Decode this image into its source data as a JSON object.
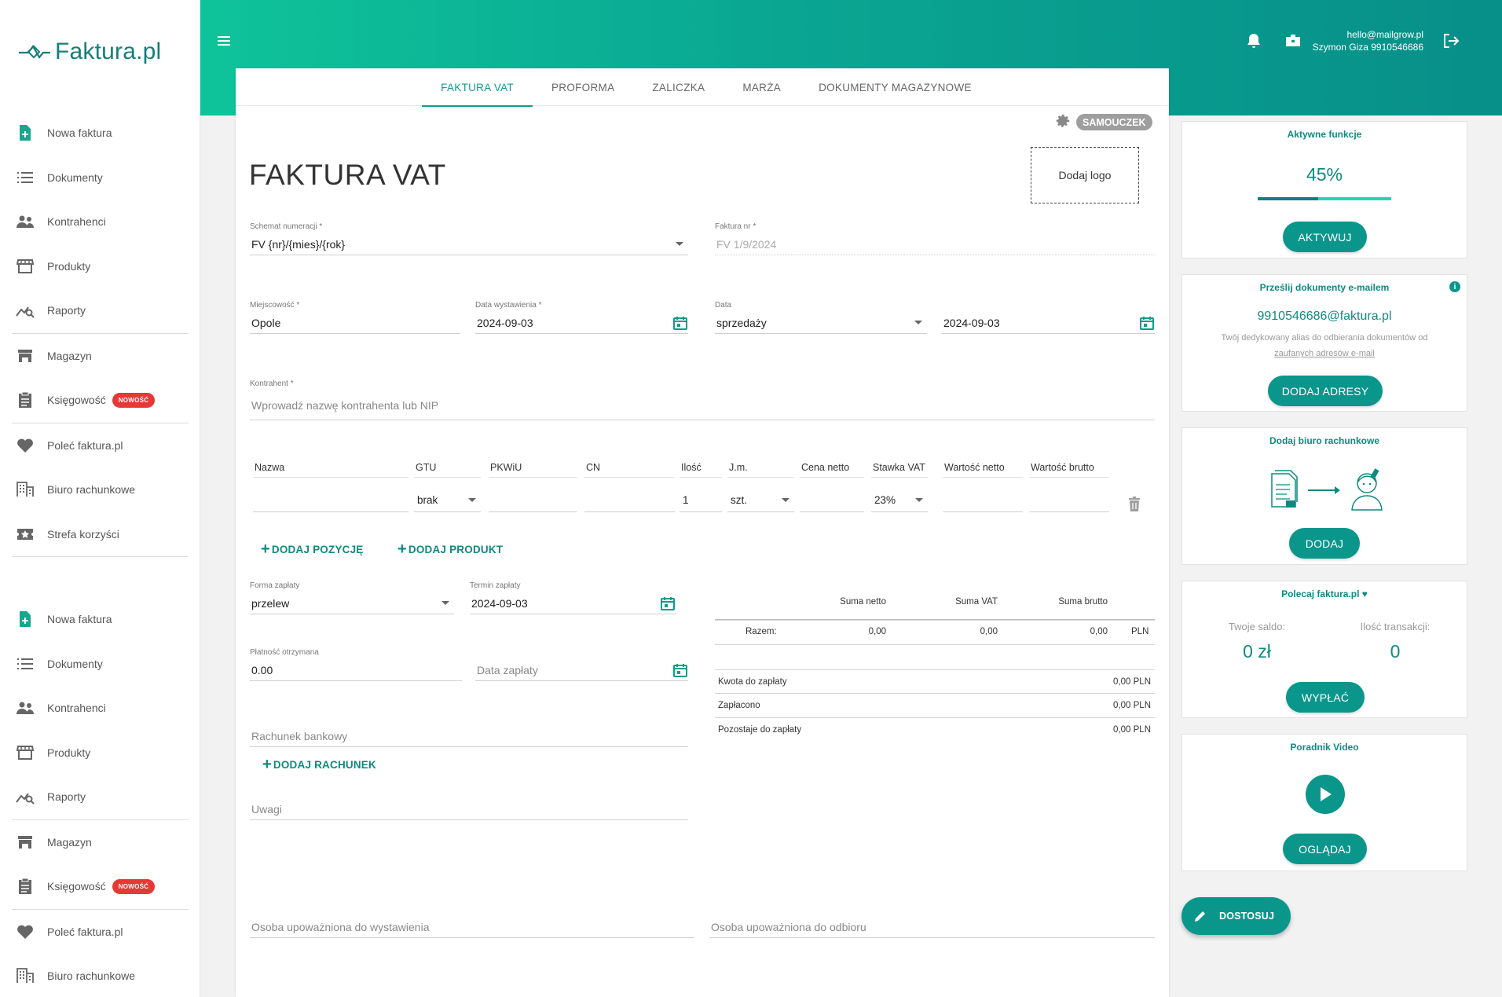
{
  "brand": {
    "logo_text": "Faktura.pl",
    "accent": "#0b968c",
    "badge_color": "#e53935"
  },
  "sidebar": {
    "groups": [
      {
        "items": [
          {
            "label": "Nowa faktura",
            "icon": "file-plus-icon"
          },
          {
            "label": "Dokumenty",
            "icon": "list-icon"
          },
          {
            "label": "Kontrahenci",
            "icon": "people-icon"
          },
          {
            "label": "Produkty",
            "icon": "store-icon"
          },
          {
            "label": "Raporty",
            "icon": "chart-search-icon"
          },
          {
            "label": "Magazyn",
            "icon": "warehouse-icon"
          },
          {
            "label": "Księgowość",
            "icon": "clipboard-icon",
            "badge": "NOWOŚĆ"
          },
          {
            "label": "Poleć faktura.pl",
            "icon": "heart-icon"
          },
          {
            "label": "Biuro rachunkowe",
            "icon": "building-icon"
          },
          {
            "label": "Strefa korzyści",
            "icon": "star-ticket-icon"
          }
        ]
      },
      {
        "items": [
          {
            "label": "Nowa faktura",
            "icon": "file-plus-icon"
          },
          {
            "label": "Dokumenty",
            "icon": "list-icon"
          },
          {
            "label": "Kontrahenci",
            "icon": "people-icon"
          },
          {
            "label": "Produkty",
            "icon": "store-icon"
          },
          {
            "label": "Raporty",
            "icon": "chart-search-icon"
          },
          {
            "label": "Magazyn",
            "icon": "warehouse-icon"
          },
          {
            "label": "Księgowość",
            "icon": "clipboard-icon",
            "badge": "NOWOŚĆ"
          },
          {
            "label": "Poleć faktura.pl",
            "icon": "heart-icon"
          },
          {
            "label": "Biuro rachunkowe",
            "icon": "building-icon"
          }
        ]
      }
    ]
  },
  "header": {
    "email": "hello@mailgrow.pl",
    "user": "Szymon Giza 9910546686"
  },
  "tabs": [
    "FAKTURA VAT",
    "PROFORMA",
    "ZALICZKA",
    "MARŻA",
    "DOKUMENTY MAGAZYNOWE"
  ],
  "form": {
    "tutorial": "SAMOUCZEK",
    "add_logo": "Dodaj logo",
    "title": "FAKTURA VAT",
    "numbering": {
      "label": "Schemat numeracji *",
      "value": "FV {nr}/{mies}/{rok}"
    },
    "invoice_no": {
      "label": "Faktura nr *",
      "value": "FV 1/9/2024"
    },
    "city": {
      "label": "Miejscowość *",
      "value": "Opole"
    },
    "issue_date": {
      "label": "Data wystawienia *",
      "value": "2024-09-03"
    },
    "date": {
      "label": "Data",
      "type": "sprzedaży",
      "value": "2024-09-03"
    },
    "contractor": {
      "label": "Kontrahent *",
      "placeholder": "Wprowadź nazwę kontrahenta lub NIP"
    },
    "items": {
      "headers": [
        "Nazwa",
        "GTU",
        "PKWiU",
        "CN",
        "Ilość",
        "J.m.",
        "Cena netto",
        "Stawka VAT",
        "Wartość netto",
        "Wartość brutto"
      ],
      "row": {
        "gtu": "brak",
        "qty": "1",
        "unit": "szt.",
        "vat": "23%"
      }
    },
    "add_position": "DODAJ POZYCJĘ",
    "add_product": "DODAJ PRODUKT",
    "payment_form": {
      "label": "Forma zapłaty",
      "value": "przelew"
    },
    "payment_due": {
      "label": "Termin zapłaty",
      "value": "2024-09-03"
    },
    "payment_received": {
      "label": "Płatność otrzymana",
      "value": "0.00"
    },
    "payment_date": {
      "placeholder": "Data zapłaty"
    },
    "bank_account": {
      "placeholder": "Rachunek bankowy"
    },
    "add_account": "DODAJ RACHUNEK",
    "notes": {
      "placeholder": "Uwagi"
    },
    "issuer": {
      "placeholder": "Osoba upoważniona do wystawienia"
    },
    "receiver": {
      "placeholder": "Osoba upoważniona do odbioru"
    }
  },
  "summary": {
    "headers": [
      "Suma netto",
      "Suma VAT",
      "Suma brutto"
    ],
    "total_label": "Razem:",
    "net": "0,00",
    "vat": "0,00",
    "gross": "0,00",
    "currency": "PLN",
    "rows": [
      {
        "label": "Kwota do zapłaty",
        "value": "0,00 PLN"
      },
      {
        "label": "Zapłacono",
        "value": "0,00 PLN"
      },
      {
        "label": "Pozostaje do zapłaty",
        "value": "0,00 PLN"
      }
    ]
  },
  "widgets": {
    "active": {
      "title": "Aktywne funkcje",
      "percent": "45%",
      "progress": 0.45,
      "button": "AKTYWUJ"
    },
    "email": {
      "title": "Prześlij dokumenty e-mailem",
      "address": "9910546686@faktura.pl",
      "desc": "Twój dedykowany alias do odbierania dokumentów od",
      "link": "zaufanych adresów e-mail",
      "button": "DODAJ ADRESY"
    },
    "office": {
      "title": "Dodaj biuro rachunkowe",
      "button": "DODAJ"
    },
    "recommend": {
      "title": "Polecaj faktura.pl",
      "balance_label": "Twoje saldo:",
      "balance": "0 zł",
      "tx_label": "Ilość transakcji:",
      "tx": "0",
      "button": "WYPŁAĆ"
    },
    "video": {
      "title": "Poradnik Video",
      "button": "OGLĄDAJ"
    }
  },
  "customize": "DOSTOSUJ"
}
